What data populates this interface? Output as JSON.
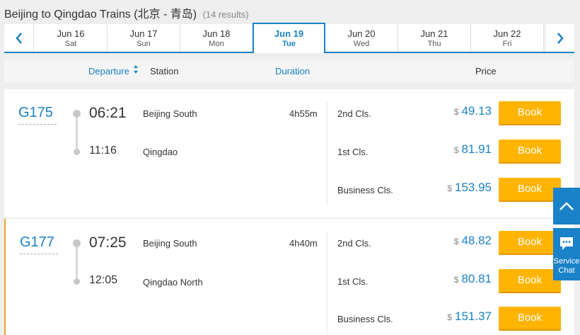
{
  "header": {
    "title": "Beijing to Qingdao Trains",
    "route_cn": "(北京 - 青岛)",
    "results": "(14 results)"
  },
  "dates": [
    {
      "date": "Jun 16",
      "weekday": "Sat"
    },
    {
      "date": "Jun 17",
      "weekday": "Sun"
    },
    {
      "date": "Jun 18",
      "weekday": "Mon"
    },
    {
      "date": "Jun 19",
      "weekday": "Tue"
    },
    {
      "date": "Jun 20",
      "weekday": "Wed"
    },
    {
      "date": "Jun 21",
      "weekday": "Thu"
    },
    {
      "date": "Jun 22",
      "weekday": "Fri"
    }
  ],
  "active_date_index": 3,
  "columns": {
    "departure": "Departure",
    "station": "Station",
    "duration": "Duration",
    "price": "Price"
  },
  "trains": [
    {
      "number": "G175",
      "dep_time": "06:21",
      "arr_time": "11:16",
      "dep_station": "Beijing South",
      "arr_station": "Qingdao",
      "duration": "4h55m",
      "seats": [
        {
          "class": "2nd Cls.",
          "currency": "$",
          "price": "49.13",
          "action": "Book"
        },
        {
          "class": "1st Cls.",
          "currency": "$",
          "price": "81.91",
          "action": "Book"
        },
        {
          "class": "Business Cls.",
          "currency": "$",
          "price": "153.95",
          "action": "Book"
        }
      ]
    },
    {
      "number": "G177",
      "dep_time": "07:25",
      "arr_time": "12:05",
      "dep_station": "Beijing South",
      "arr_station": "Qingdao North",
      "duration": "4h40m",
      "seats": [
        {
          "class": "2nd Cls.",
          "currency": "$",
          "price": "48.82",
          "action": "Book"
        },
        {
          "class": "1st Cls.",
          "currency": "$",
          "price": "80.81",
          "action": "Book"
        },
        {
          "class": "Business Cls.",
          "currency": "$",
          "price": "151.37",
          "action": "Book"
        }
      ]
    }
  ],
  "floating": {
    "chat_label": "Service Chat"
  },
  "colors": {
    "accent": "#1a82c7",
    "book_button": "#ffb400",
    "selected_border": "#f5a623"
  }
}
